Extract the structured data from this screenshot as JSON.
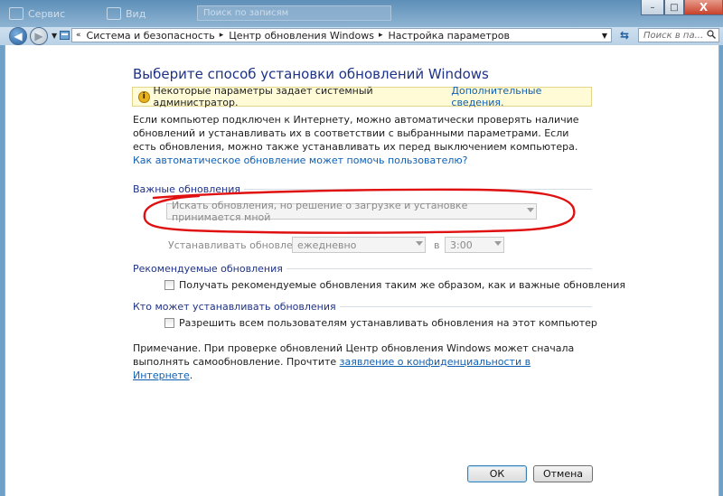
{
  "topbar": {
    "organize_label": "Сервис",
    "views_label": "Вид",
    "search_placeholder": "Поиск по записям"
  },
  "window_controls": {
    "minimize": "–",
    "maximize": "□",
    "close": "X"
  },
  "address": {
    "crumbs": [
      "Система и безопасность",
      "Центр обновления Windows",
      "Настройка параметров"
    ],
    "search_placeholder": "Поиск в па..."
  },
  "page": {
    "title": "Выберите способ установки обновлений Windows",
    "info_text": "Некоторые параметры задает системный администратор.",
    "info_link": "Дополнительные сведения.",
    "description": "Если компьютер подключен к Интернету, можно автоматически проверять наличие обновлений и устанавливать их в соответствии с выбранными параметрами. Если есть обновления, можно также устанавливать их перед выключением компьютера.",
    "help_link": "Как автоматическое обновление может помочь пользователю?"
  },
  "important": {
    "header": "Важные обновления",
    "mode_value": "Искать обновления, но решение о загрузке и установке принимается мной",
    "install_label": "Устанавливать обновления:",
    "day_value": "ежедневно",
    "at_label": "в",
    "time_value": "3:00"
  },
  "recommended": {
    "header": "Рекомендуемые обновления",
    "checkbox_label": "Получать рекомендуемые обновления таким же образом, как и важные обновления"
  },
  "who": {
    "header": "Кто может устанавливать обновления",
    "checkbox_label": "Разрешить всем пользователям устанавливать обновления на этот компьютер"
  },
  "note": {
    "text": "Примечание. При проверке обновлений Центр обновления Windows может сначала выполнять самообновление. Прочтите",
    "link": "заявление о конфиденциальности в Интернете"
  },
  "buttons": {
    "ok": "ОК",
    "cancel": "Отмена"
  },
  "colors": {
    "title": "#1e3287",
    "link": "#0f5fb3",
    "annotation": "#e01010"
  }
}
